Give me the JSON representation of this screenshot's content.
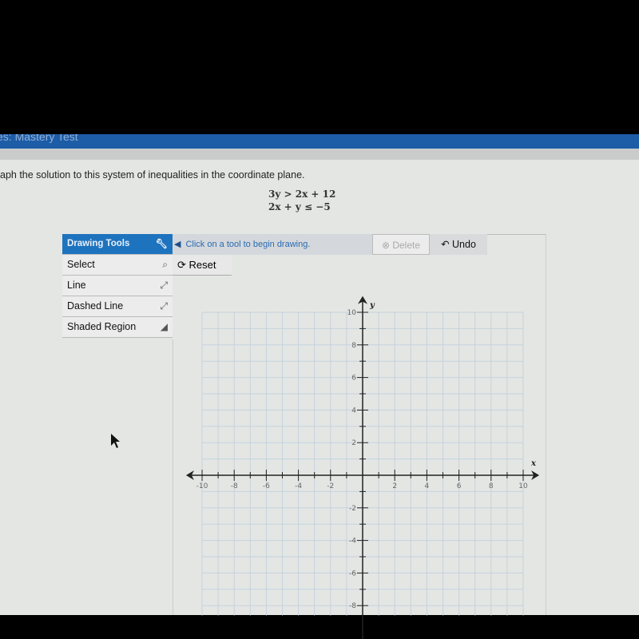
{
  "header": {
    "title": "es: Mastery Test"
  },
  "question": {
    "prompt": "aph the solution to this system of inequalities in the coordinate plane.",
    "inequalities": [
      "3y > 2x + 12",
      "2x + y ≤ −5"
    ]
  },
  "toolbar": {
    "title": "Drawing Tools",
    "hint": "Click on a tool to begin drawing.",
    "delete_label": "Delete",
    "undo_label": "Undo",
    "reset_label": "Reset",
    "tools": [
      {
        "label": "Select",
        "icon": "pointer-icon"
      },
      {
        "label": "Line",
        "icon": "line-arrows-icon"
      },
      {
        "label": "Dashed Line",
        "icon": "dashed-line-icon"
      },
      {
        "label": "Shaded Region",
        "icon": "shaded-region-icon"
      }
    ]
  },
  "graph": {
    "x_label": "x",
    "y_label": "y",
    "x_range": [
      -10,
      10
    ],
    "y_range": [
      -10,
      10
    ],
    "x_tick_labels": [
      "-10",
      "-8",
      "-6",
      "-4",
      "-2",
      "2",
      "4",
      "6",
      "8",
      "10"
    ],
    "y_tick_labels": [
      "10",
      "8",
      "6",
      "4",
      "2",
      "-2",
      "-4",
      "-6",
      "-8"
    ],
    "grid": true
  }
}
